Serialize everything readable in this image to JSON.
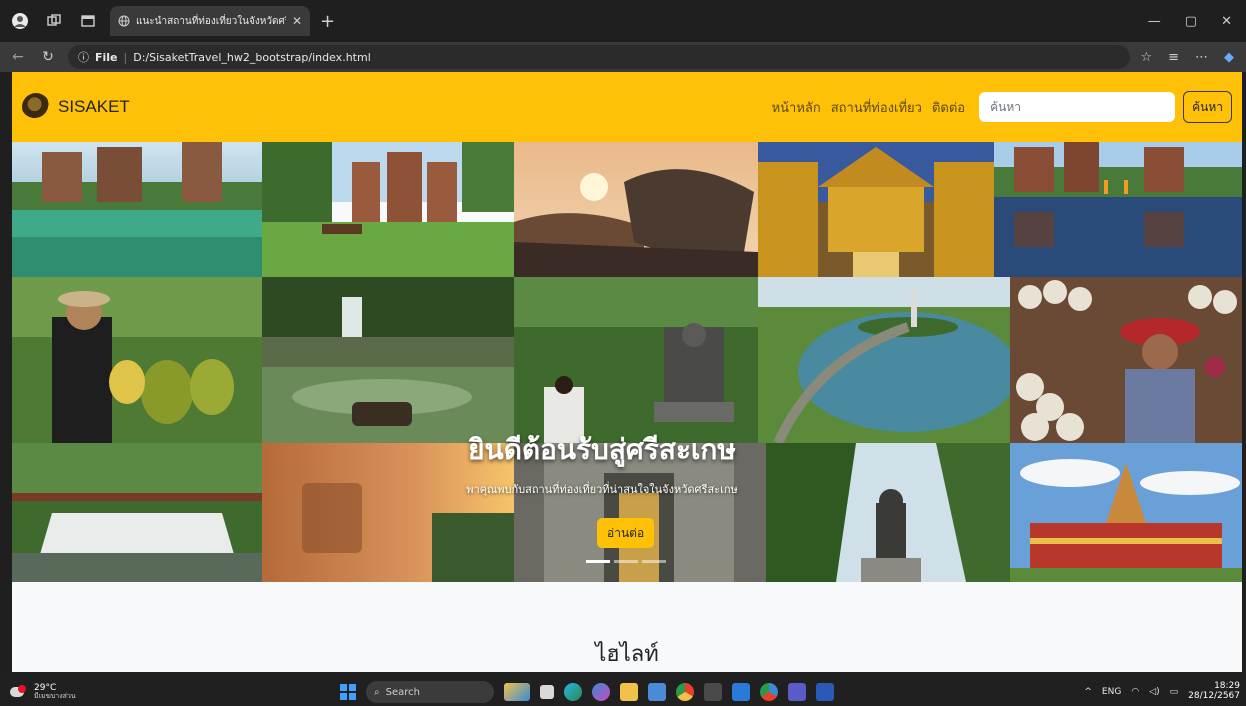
{
  "browser": {
    "tab_title": "แนะนำสถานที่ท่องเที่ยวในจังหวัดศรีสะเกษ",
    "url_scheme": "File",
    "url_path": "D:/SisaketTravel_hw2_bootstrap/index.html"
  },
  "navbar": {
    "brand": "SISAKET",
    "links": [
      "หน้าหลัก",
      "สถานที่ท่องเที่ยว",
      "ติดต่อ"
    ],
    "search_placeholder": "ค้นหา",
    "search_button": "ค้นหา",
    "color": "#ffc107"
  },
  "hero": {
    "title": "ยินดีต้อนรับสู่ศรีสะเกษ",
    "subtitle": "พาคุณพบกับสถานที่ท่องเที่ยวที่น่าสนใจในจังหวัดศรีสะเกษ",
    "button": "อ่านต่อ",
    "photos": [
      "prasat-temple-pond",
      "brick-sanctuary-lawn",
      "pha-mo-i-daeng-rock",
      "golden-temple-naga",
      "temple-reflection-monks",
      "durian-farmer",
      "forest-waterfall",
      "statue-in-forest",
      "lake-tower-aerial",
      "garlic-seller",
      "cascade-rocks",
      "rock-carving-sunset",
      "stone-relief-door",
      "buddha-statue-palms",
      "red-gold-temple"
    ],
    "slides": 3,
    "active_slide": 0
  },
  "section": {
    "heading": "ไฮไลท์"
  },
  "taskbar": {
    "temperature": "29°C",
    "weather_desc": "มีเมฆบางส่วน",
    "search": "Search",
    "language": "ENG",
    "time": "18:29",
    "date": "28/12/2567"
  }
}
